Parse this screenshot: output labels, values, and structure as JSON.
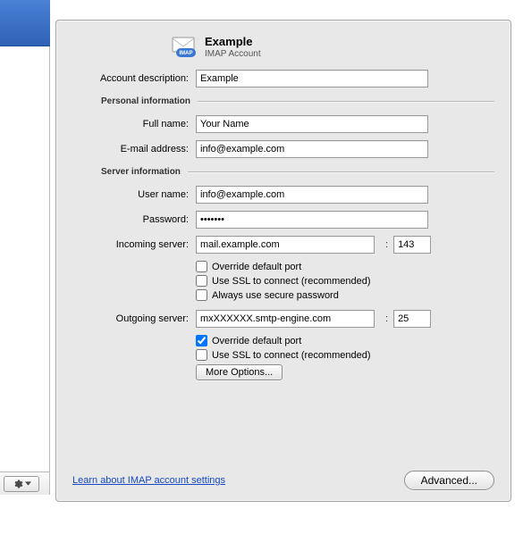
{
  "header": {
    "title": "Example",
    "subtitle": "IMAP Account"
  },
  "labels": {
    "account_description": "Account description:",
    "personal_information": "Personal information",
    "full_name": "Full name:",
    "email_address": "E-mail address:",
    "server_information": "Server information",
    "user_name": "User name:",
    "password": "Password:",
    "incoming_server": "Incoming server:",
    "outgoing_server": "Outgoing server:",
    "port_separator": ":"
  },
  "fields": {
    "account_description": "Example",
    "full_name": "Your Name",
    "email_address": "info@example.com",
    "user_name": "info@example.com",
    "password": "•••••••",
    "incoming_server": "mail.example.com",
    "incoming_port": "143",
    "outgoing_server": "mxXXXXXX.smtp-engine.com",
    "outgoing_port": "25"
  },
  "checkboxes": {
    "incoming_override_port": {
      "label": "Override default port",
      "checked": false
    },
    "incoming_use_ssl": {
      "label": "Use SSL to connect (recommended)",
      "checked": false
    },
    "incoming_secure_password": {
      "label": "Always use secure password",
      "checked": false
    },
    "outgoing_override_port": {
      "label": "Override default port",
      "checked": true
    },
    "outgoing_use_ssl": {
      "label": "Use SSL to connect (recommended)",
      "checked": false
    }
  },
  "buttons": {
    "more_options": "More Options...",
    "advanced": "Advanced..."
  },
  "link": {
    "learn_more": "Learn about IMAP account settings"
  }
}
